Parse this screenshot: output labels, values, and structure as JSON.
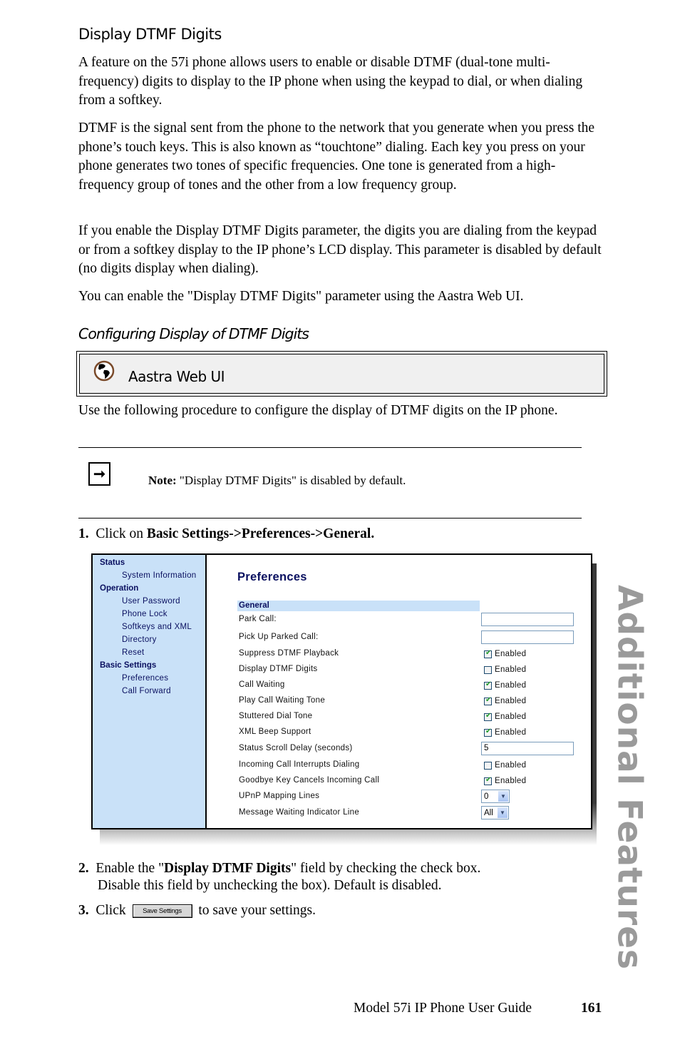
{
  "heading": "Display DTMF Digits",
  "paragraphs": [
    "A feature on the 57i phone allows users to enable or disable DTMF (dual-tone multi-frequency) digits to display to the IP phone when using the keypad to dial, or when dialing from a softkey.",
    "DTMF is the signal sent from the phone to the network that you generate when you press the phone’s touch keys. This is also known as “touchtone” dialing. Each key you press on your phone generates two tones of specific frequencies. One tone is generated from a high-frequency group of tones and the other from a low frequency group.",
    "If you enable the Display DTMF Digits parameter, the digits you are dialing from the keypad or from a softkey display to the IP phone’s LCD display. This parameter is disabled by default (no digits display when dialing).",
    "You can enable the \"Display DTMF Digits\" parameter using the Aastra Web UI."
  ],
  "subheading": "Configuring Display of DTMF Digits",
  "webui_box": {
    "icon": "globe-icon",
    "label": "Aastra Web UI"
  },
  "intro": "Use the following procedure to configure the display of DTMF digits on the IP phone.",
  "note": {
    "icon": "arrow-right-icon",
    "label": "Note:",
    "text": " \"Display DTMF Digits\" is disabled by default."
  },
  "steps": {
    "s1": {
      "num": "1.",
      "pre": "Click on ",
      "bold": "Basic Settings->Preferences->General."
    },
    "s2": {
      "num": "2.",
      "pre": "Enable the \"",
      "bold": "Display DTMF Digits",
      "post": "\" field by checking the check box.",
      "line2": "Disable this field by unchecking the box). Default is disabled."
    },
    "s3": {
      "num": "3.",
      "pre": "Click",
      "button": "Save Settings",
      "post": "to save your settings."
    }
  },
  "screenshot": {
    "sidebar": [
      {
        "group": "Status",
        "items": [
          "System Information"
        ]
      },
      {
        "group": "Operation",
        "items": [
          "User Password",
          "Phone Lock",
          "Softkeys and XML",
          "Directory",
          "Reset"
        ]
      },
      {
        "group": "Basic Settings",
        "items": [
          "Preferences",
          "Call Forward"
        ]
      }
    ],
    "title": "Preferences",
    "section": "General",
    "rows": [
      {
        "label": "Park Call:",
        "type": "text",
        "value": ""
      },
      {
        "label": "Pick Up Parked Call:",
        "type": "text",
        "value": ""
      },
      {
        "label": "Suppress DTMF Playback",
        "type": "check",
        "checked": true,
        "text": "Enabled"
      },
      {
        "label": "Display DTMF Digits",
        "type": "check",
        "checked": false,
        "text": "Enabled"
      },
      {
        "label": "Call Waiting",
        "type": "check",
        "checked": true,
        "text": "Enabled"
      },
      {
        "label": "Play Call Waiting Tone",
        "type": "check",
        "checked": true,
        "text": "Enabled"
      },
      {
        "label": "Stuttered Dial Tone",
        "type": "check",
        "checked": true,
        "text": "Enabled"
      },
      {
        "label": "XML Beep Support",
        "type": "check",
        "checked": true,
        "text": "Enabled"
      },
      {
        "label": "Status Scroll Delay (seconds)",
        "type": "text",
        "value": "5"
      },
      {
        "label": "Incoming Call Interrupts Dialing",
        "type": "check",
        "checked": false,
        "text": "Enabled"
      },
      {
        "label": "Goodbye Key Cancels Incoming Call",
        "type": "check",
        "checked": true,
        "text": "Enabled"
      },
      {
        "label": "UPnP Mapping Lines",
        "type": "select",
        "value": "0"
      },
      {
        "label": "Message Waiting Indicator Line",
        "type": "select",
        "value": "All"
      }
    ]
  },
  "side_tab": "Additional Features",
  "footer": {
    "title": "Model 57i IP Phone User Guide",
    "page": "161"
  }
}
